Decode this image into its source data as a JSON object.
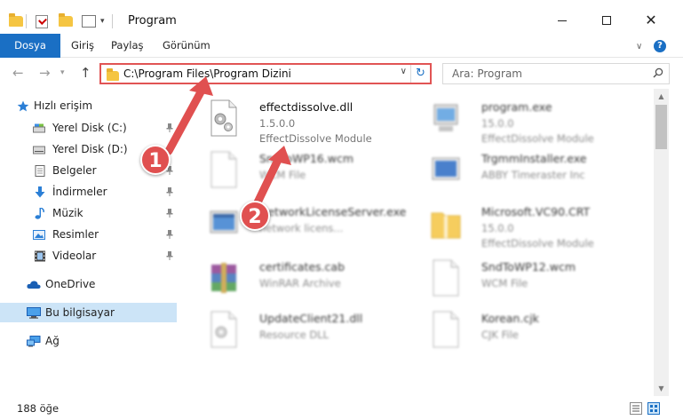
{
  "window": {
    "title": "Program"
  },
  "ribbon": {
    "tabs": [
      "Dosya",
      "Giriş",
      "Paylaş",
      "Görünüm"
    ]
  },
  "address": {
    "path": "C:\\Program Files\\Program Dizini"
  },
  "search": {
    "placeholder": "Ara: Program"
  },
  "sidebar": {
    "items": [
      {
        "label": "Hızlı erişim"
      },
      {
        "label": "Yerel Disk (C:)"
      },
      {
        "label": "Yerel Disk (D:)"
      },
      {
        "label": "Belgeler"
      },
      {
        "label": "İndirmeler"
      },
      {
        "label": "Müzik"
      },
      {
        "label": "Resimler"
      },
      {
        "label": "Videolar"
      },
      {
        "label": "OneDrive"
      },
      {
        "label": "Bu bilgisayar"
      },
      {
        "label": "Ağ"
      }
    ]
  },
  "files": [
    {
      "name": "effectdissolve.dll",
      "line2": "1.5.0.0",
      "line3": "EffectDissolve Module"
    },
    {
      "name": "program.exe",
      "line2": "15.0.0",
      "line3": "EffectDissolve Module"
    },
    {
      "name": "SndToWP16.wcm",
      "line2": "WCM File",
      "line3": ""
    },
    {
      "name": "TrgmmInstaller.exe",
      "line2": "ABBY Timeraster Inc",
      "line3": ""
    },
    {
      "name": "NetworkLicenseServer.exe",
      "line2": "network licens...",
      "line3": ""
    },
    {
      "name": "Microsoft.VC90.CRT",
      "line2": "15.0.0",
      "line3": "EffectDissolve Module"
    },
    {
      "name": "certificates.cab",
      "line2": "WinRAR Archive",
      "line3": ""
    },
    {
      "name": "SndToWP12.wcm",
      "line2": "WCM File",
      "line3": ""
    },
    {
      "name": "UpdateClient21.dll",
      "line2": "Resource DLL",
      "line3": ""
    },
    {
      "name": "Korean.cjk",
      "line2": "CJK File",
      "line3": ""
    }
  ],
  "status": {
    "count": "188 öğe"
  },
  "markers": [
    "1",
    "2"
  ],
  "colors": {
    "accent": "#1a6fc4",
    "highlight": "#e15454",
    "selected": "#cce4f7"
  }
}
